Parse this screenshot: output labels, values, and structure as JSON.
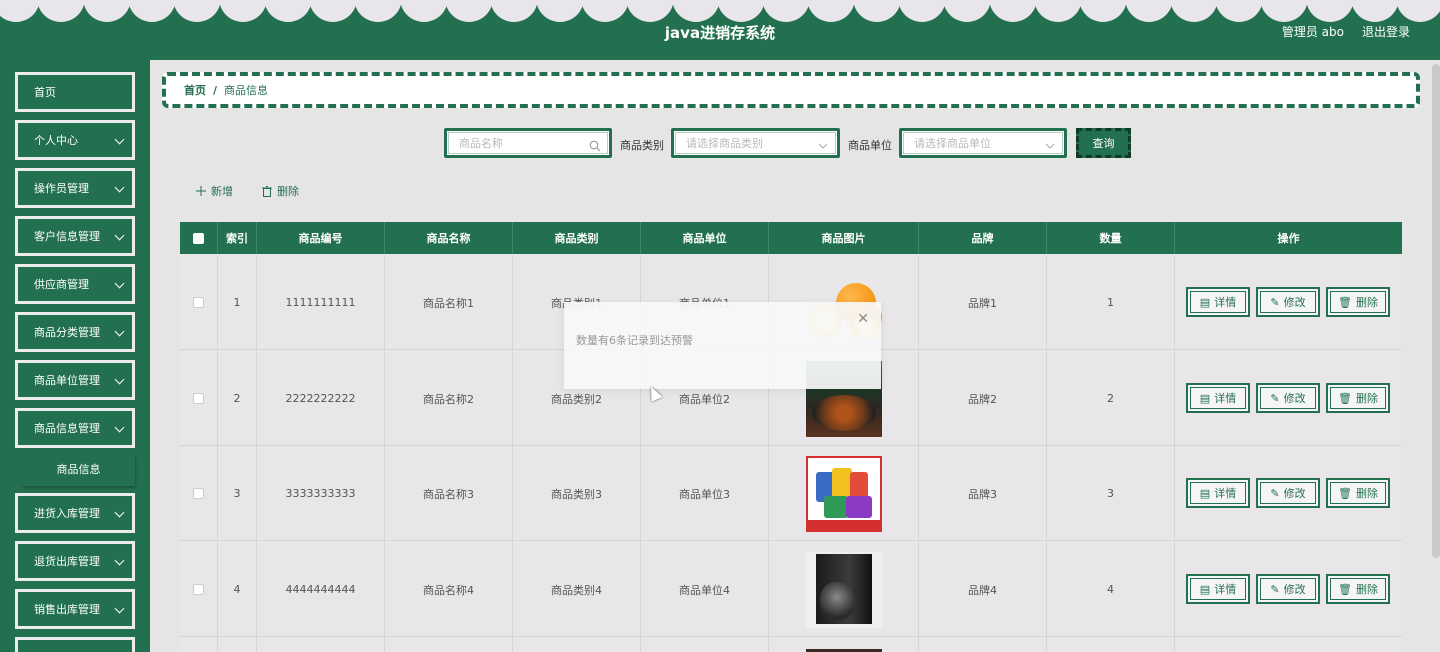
{
  "header": {
    "title": "java进销存系统",
    "user": "管理员 abo",
    "logout": "退出登录"
  },
  "sidebar": {
    "items": [
      {
        "label": "首页",
        "expandable": false
      },
      {
        "label": "个人中心",
        "expandable": true
      },
      {
        "label": "操作员管理",
        "expandable": true
      },
      {
        "label": "客户信息管理",
        "expandable": true
      },
      {
        "label": "供应商管理",
        "expandable": true
      },
      {
        "label": "商品分类管理",
        "expandable": true
      },
      {
        "label": "商品单位管理",
        "expandable": true
      },
      {
        "label": "商品信息管理",
        "expandable": true
      },
      {
        "label": "进货入库管理",
        "expandable": true
      },
      {
        "label": "退货出库管理",
        "expandable": true
      },
      {
        "label": "销售出库管理",
        "expandable": true
      }
    ],
    "submenu": {
      "label": "商品信息"
    }
  },
  "breadcrumb": {
    "home": "首页",
    "separator": "/",
    "current": "商品信息"
  },
  "search": {
    "name_placeholder": "商品名称",
    "category_label": "商品类别",
    "category_placeholder": "请选择商品类别",
    "unit_label": "商品单位",
    "unit_placeholder": "请选择商品单位",
    "query_button": "查询"
  },
  "actions": {
    "add": "新增",
    "delete": "删除"
  },
  "table": {
    "columns": [
      "索引",
      "商品编号",
      "商品名称",
      "商品类别",
      "商品单位",
      "商品图片",
      "品牌",
      "数量",
      "操作"
    ],
    "rows": [
      {
        "index": "1",
        "code": "1111111111",
        "name": "商品名称1",
        "category": "商品类别1",
        "unit": "商品单位1",
        "image": "oranges",
        "brand": "品牌1",
        "qty": "1"
      },
      {
        "index": "2",
        "code": "2222222222",
        "name": "商品名称2",
        "category": "商品类别2",
        "unit": "商品单位2",
        "image": "food-dish",
        "brand": "品牌2",
        "qty": "2"
      },
      {
        "index": "3",
        "code": "3333333333",
        "name": "商品名称3",
        "category": "商品类别3",
        "unit": "商品单位3",
        "image": "snack-pack",
        "brand": "品牌3",
        "qty": "3"
      },
      {
        "index": "4",
        "code": "4444444444",
        "name": "商品名称4",
        "category": "商品类别4",
        "unit": "商品单位4",
        "image": "book-set",
        "brand": "品牌4",
        "qty": "4"
      }
    ],
    "row_buttons": {
      "detail": "详情",
      "edit": "修改",
      "delete": "删除"
    }
  },
  "toast": {
    "message": "数量有6条记录到达预警"
  },
  "colors": {
    "primary": "#237050",
    "background": "#e6e5e6"
  }
}
